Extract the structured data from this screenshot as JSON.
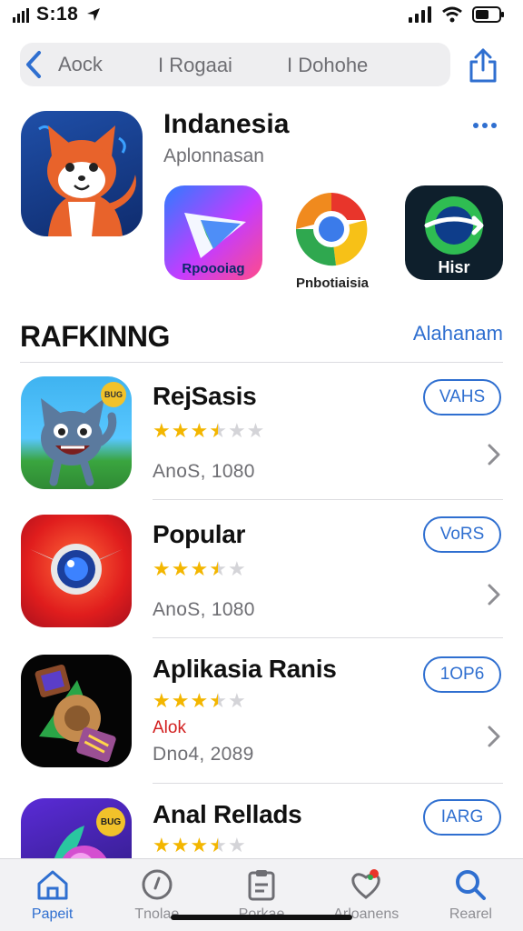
{
  "status_bar": {
    "time": "S:18"
  },
  "nav": {
    "back_label": "Aock",
    "segments": [
      "I Rogaai",
      "I Dohohe"
    ]
  },
  "featured": {
    "title": "Indanesia",
    "subtitle": "Aplonnasan",
    "mini_apps": [
      {
        "label": "Rpoooiag"
      },
      {
        "label": "Pnbotiaisia"
      },
      {
        "label": "Hisr"
      }
    ]
  },
  "ranking": {
    "title": "RAFKINNG",
    "link": "Alahanam",
    "items": [
      {
        "name": "RejSasis",
        "rating": 3.5,
        "tag": "",
        "meta": "AnoS,  1080",
        "button": "VAHS",
        "badge": "BUG"
      },
      {
        "name": "Popular",
        "rating": 3.5,
        "tag": "",
        "meta": "AnoS,  1080",
        "button": "VoRS",
        "badge": ""
      },
      {
        "name": "Aplikasia Ranis",
        "rating": 3.5,
        "tag": "Alok",
        "meta": "Dno4,  2089",
        "button": "1OP6",
        "badge": ""
      },
      {
        "name": "Anal Rellads",
        "rating": 3.5,
        "tag": "",
        "meta": "",
        "button": "IARG",
        "badge": "BUG"
      }
    ]
  },
  "tabs": [
    {
      "label": "Papeit",
      "icon": "home-icon",
      "active": true
    },
    {
      "label": "Tnolae",
      "icon": "clock-icon",
      "active": false
    },
    {
      "label": "Porkae",
      "icon": "clipboard-icon",
      "active": false
    },
    {
      "label": "Arloanens",
      "icon": "heart-icon",
      "active": false
    },
    {
      "label": "Rearel",
      "icon": "search-icon",
      "active": false
    }
  ],
  "colors": {
    "accent": "#2f6fd0",
    "star": "#f3b600",
    "tag": "#d21f1f"
  }
}
